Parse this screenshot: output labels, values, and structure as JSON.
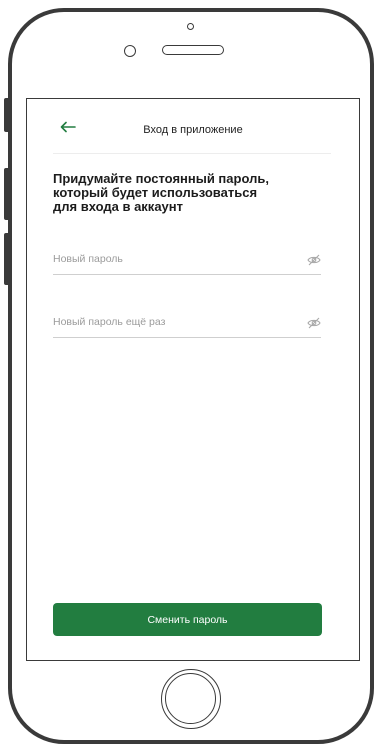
{
  "header": {
    "title": "Вход в приложение",
    "back_icon": "arrow-left-icon"
  },
  "main": {
    "heading_lines": [
      "Придумайте постоянный пароль,",
      "который будет использоваться",
      "для входа в аккаунт"
    ],
    "fields": [
      {
        "placeholder": "Новый пароль",
        "value": "",
        "icon": "eye-icon"
      },
      {
        "placeholder": "Новый пароль ещё раз",
        "value": "",
        "icon": "eye-icon"
      }
    ],
    "submit_label": "Сменить пароль"
  },
  "colors": {
    "accent": "#227d40",
    "frame": "#3a3a3a",
    "placeholder": "#9b9b9b"
  }
}
